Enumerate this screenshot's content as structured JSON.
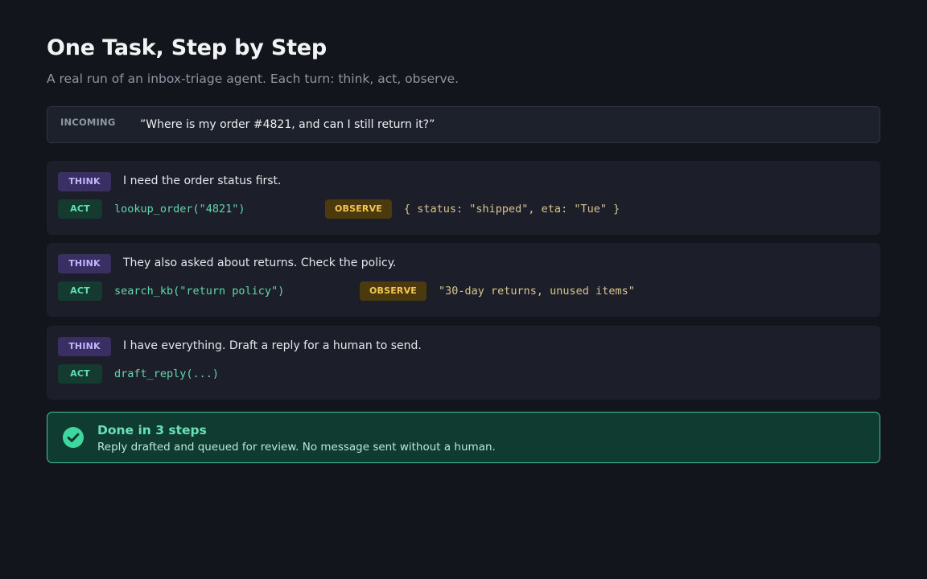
{
  "header": {
    "title": "One Task, Step by Step",
    "subtitle": "A real run of an inbox-triage agent. Each turn: think, act, observe."
  },
  "incoming": {
    "label": "INCOMING",
    "message": "”Where is my order #4821, and can I still return it?”"
  },
  "tags": {
    "think": "THINK",
    "act": "ACT",
    "observe": "OBSERVE"
  },
  "steps": [
    {
      "think": "I need the order status first.",
      "act": "lookup_order(\"4821\")",
      "observe": "{ status: \"shipped\", eta: \"Tue\" }"
    },
    {
      "think": "They also asked about returns. Check the policy.",
      "act": "search_kb(\"return policy\")",
      "observe": "\"30-day returns, unused items\""
    },
    {
      "think": "I have everything. Draft a reply for a human to send.",
      "act": "draft_reply(...)"
    }
  ],
  "done": {
    "icon": "check-circle-icon",
    "title": "Done in 3 steps",
    "message": "Reply drafted and queued for review. No message sent without a human."
  },
  "colors": {
    "background": "#12151b",
    "think_accent": "#c4b4ff",
    "act_accent": "#5fe0b0",
    "observe_accent": "#f5c751",
    "success": "#3fc79a"
  }
}
